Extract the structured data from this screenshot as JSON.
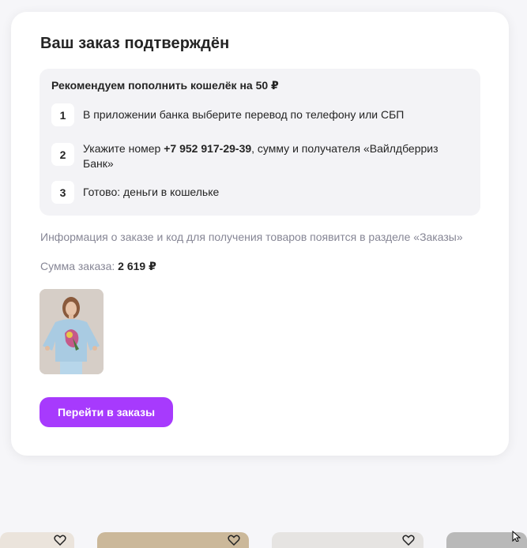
{
  "order": {
    "title": "Ваш заказ подтверждён",
    "recommend": {
      "title": "Рекомендуем пополнить кошелёк на 50 ₽",
      "steps": [
        {
          "num": "1",
          "text": "В приложении банка выберите перевод по телефону или СБП"
        },
        {
          "num": "2",
          "text_before": "Укажите номер ",
          "phone": "+7 952 917-29-39",
          "text_after": ", сумму и получателя «Вайлдберриз Банк»"
        },
        {
          "num": "3",
          "text": "Готово: деньги в кошельке"
        }
      ]
    },
    "info_text": "Информация о заказе и код для получения товаров появится в разделе «Заказы»",
    "sum_label": "Сумма заказа:",
    "sum_value": "2 619 ₽",
    "button_label": "Перейти в заказы"
  },
  "colors": {
    "accent": "#a73afd",
    "page_bg": "#f6f6f9",
    "panel_bg": "#f3f3f6",
    "muted_text": "#868695"
  },
  "icons": [
    "heart-icon",
    "cursor-icon"
  ]
}
